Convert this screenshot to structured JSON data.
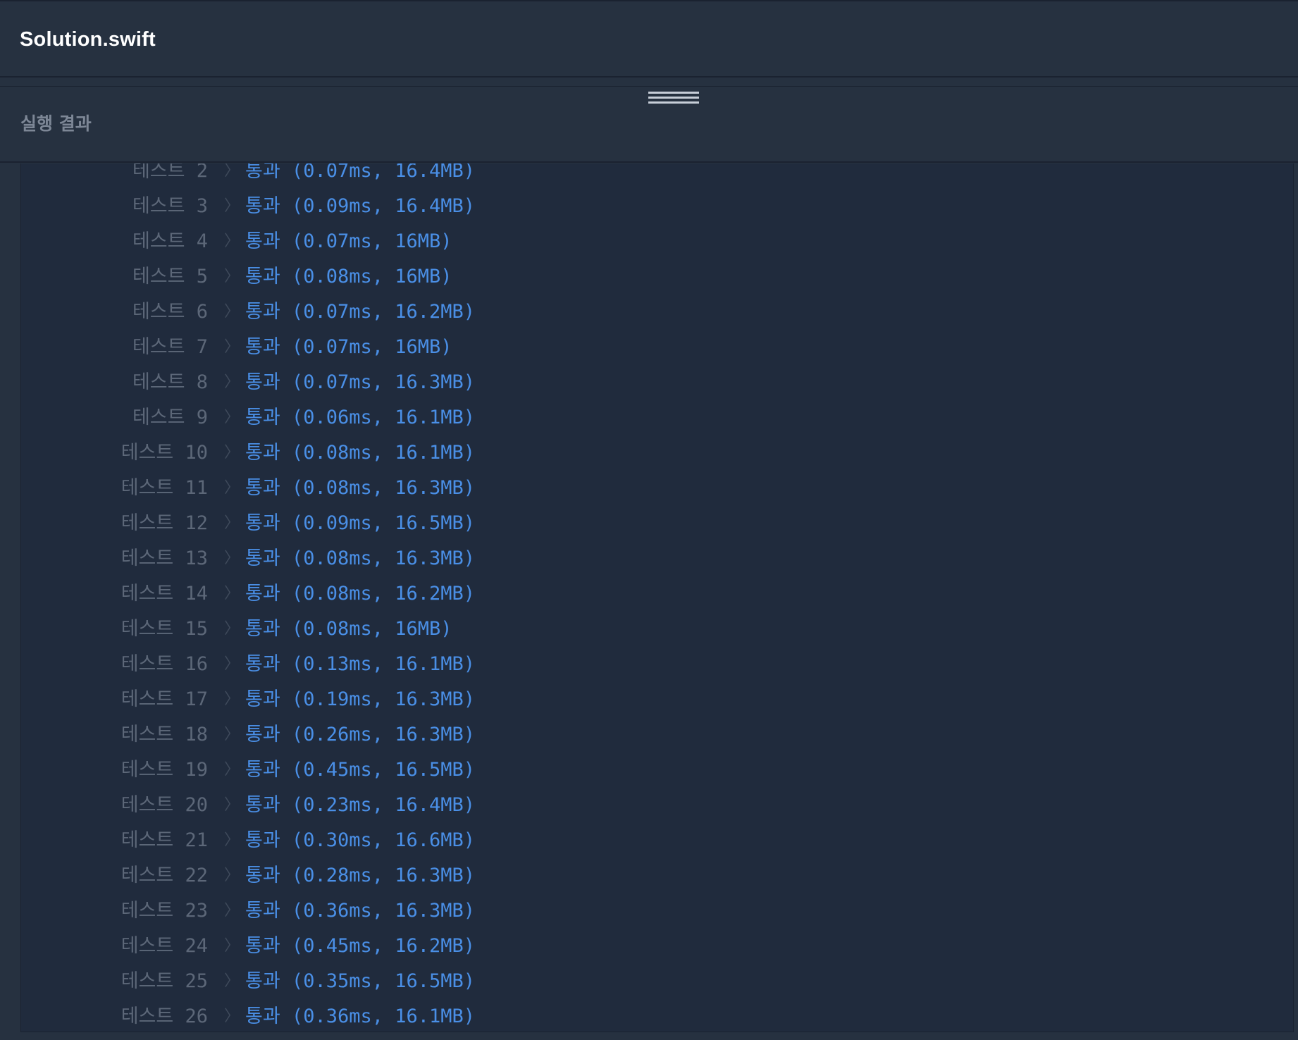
{
  "file_header": {
    "title": "Solution.swift"
  },
  "results_panel": {
    "title": "실행 결과",
    "chevron": "〉",
    "rows": [
      {
        "label": "테스트 2",
        "result": "통과 (0.07ms, 16.4MB)"
      },
      {
        "label": "테스트 3",
        "result": "통과 (0.09ms, 16.4MB)"
      },
      {
        "label": "테스트 4",
        "result": "통과 (0.07ms, 16MB)"
      },
      {
        "label": "테스트 5",
        "result": "통과 (0.08ms, 16MB)"
      },
      {
        "label": "테스트 6",
        "result": "통과 (0.07ms, 16.2MB)"
      },
      {
        "label": "테스트 7",
        "result": "통과 (0.07ms, 16MB)"
      },
      {
        "label": "테스트 8",
        "result": "통과 (0.07ms, 16.3MB)"
      },
      {
        "label": "테스트 9",
        "result": "통과 (0.06ms, 16.1MB)"
      },
      {
        "label": "테스트 10",
        "result": "통과 (0.08ms, 16.1MB)"
      },
      {
        "label": "테스트 11",
        "result": "통과 (0.08ms, 16.3MB)"
      },
      {
        "label": "테스트 12",
        "result": "통과 (0.09ms, 16.5MB)"
      },
      {
        "label": "테스트 13",
        "result": "통과 (0.08ms, 16.3MB)"
      },
      {
        "label": "테스트 14",
        "result": "통과 (0.08ms, 16.2MB)"
      },
      {
        "label": "테스트 15",
        "result": "통과 (0.08ms, 16MB)"
      },
      {
        "label": "테스트 16",
        "result": "통과 (0.13ms, 16.1MB)"
      },
      {
        "label": "테스트 17",
        "result": "통과 (0.19ms, 16.3MB)"
      },
      {
        "label": "테스트 18",
        "result": "통과 (0.26ms, 16.3MB)"
      },
      {
        "label": "테스트 19",
        "result": "통과 (0.45ms, 16.5MB)"
      },
      {
        "label": "테스트 20",
        "result": "통과 (0.23ms, 16.4MB)"
      },
      {
        "label": "테스트 21",
        "result": "통과 (0.30ms, 16.6MB)"
      },
      {
        "label": "테스트 22",
        "result": "통과 (0.28ms, 16.3MB)"
      },
      {
        "label": "테스트 23",
        "result": "통과 (0.36ms, 16.3MB)"
      },
      {
        "label": "테스트 24",
        "result": "통과 (0.45ms, 16.2MB)"
      },
      {
        "label": "테스트 25",
        "result": "통과 (0.35ms, 16.5MB)"
      },
      {
        "label": "테스트 26",
        "result": "통과 (0.36ms, 16.1MB)"
      }
    ]
  },
  "colors": {
    "background": "#263140",
    "console_background": "#202b3d",
    "label": "#5c6778",
    "result": "#4a8fe6"
  }
}
